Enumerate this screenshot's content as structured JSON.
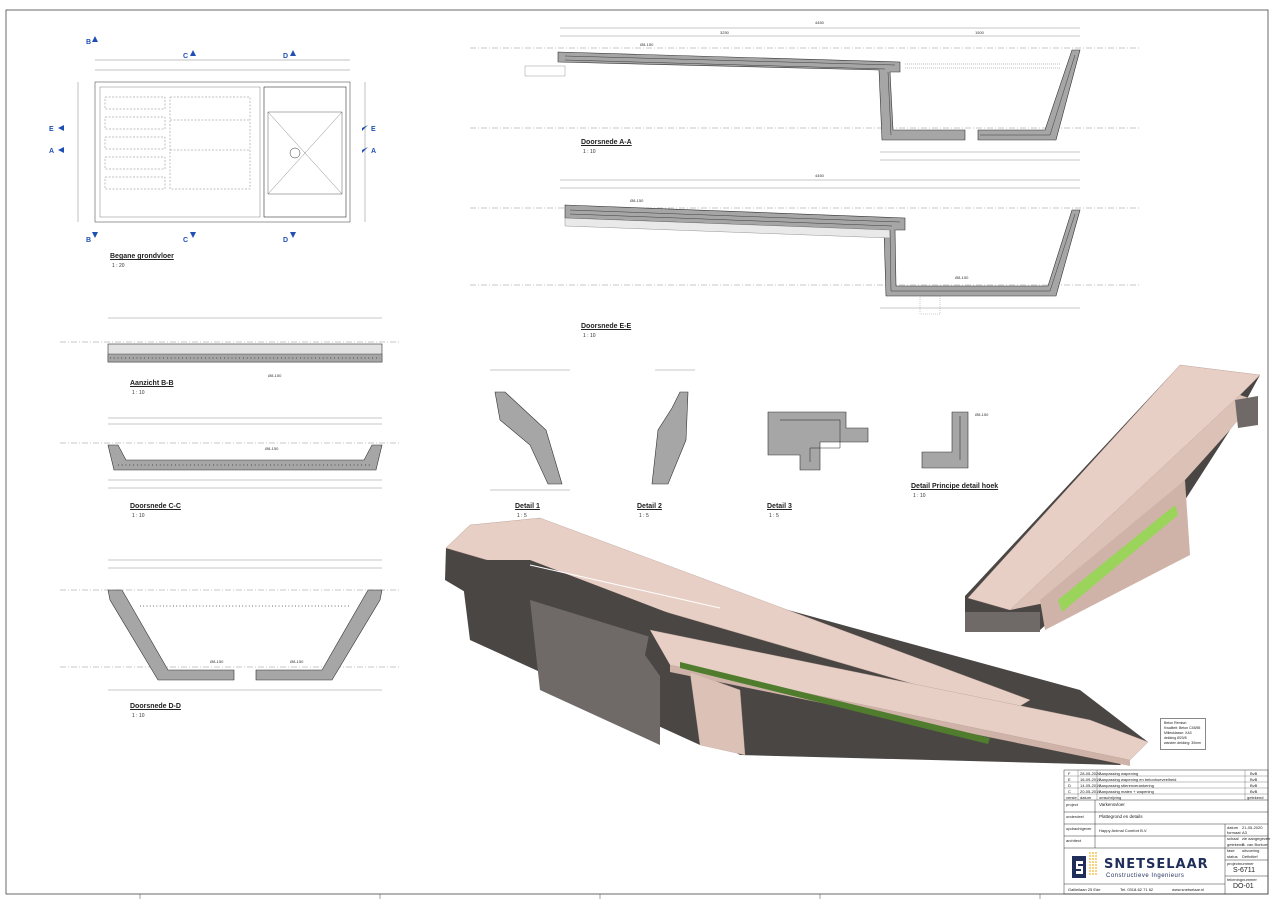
{
  "drawing_views": {
    "begane_grondvloer": {
      "title": "Begane grondvloer",
      "scale": "1 : 20"
    },
    "doorsnede_aa": {
      "title": "Doorsnede A-A",
      "scale": "1 : 10"
    },
    "doorsnede_ee": {
      "title": "Doorsnede E-E",
      "scale": "1 : 10"
    },
    "aanzicht_bb": {
      "title": "Aanzicht B-B",
      "scale": "1 : 10"
    },
    "doorsnede_cc": {
      "title": "Doorsnede C-C",
      "scale": "1 : 10"
    },
    "doorsnede_dd": {
      "title": "Doorsnede D-D",
      "scale": "1 : 10"
    },
    "detail_1": {
      "title": "Detail 1",
      "scale": "1 : 5"
    },
    "detail_2": {
      "title": "Detail 2",
      "scale": "1 : 5"
    },
    "detail_3": {
      "title": "Detail 3",
      "scale": "1 : 5"
    },
    "detail_hoek": {
      "title": "Detail Principe detail hoek",
      "scale": "1 : 10"
    }
  },
  "section_markers": [
    "A",
    "B",
    "C",
    "D",
    "E"
  ],
  "annotations": {
    "rebar_main": "Ø8-150",
    "rebar_mesh": "Ø8-150",
    "dim_total": "4450",
    "dim_left": "3250",
    "dim_right": "1500"
  },
  "beton_note": {
    "heading": "Beton Remise:",
    "lines": [
      "Kwaliteit: Beton C45/55",
      "Milieuklasse: XA3",
      "dekking Ø20/8",
      "wanden dekking: 30mm"
    ]
  },
  "revisions": [
    {
      "rev": "F",
      "date": "28-05-2020",
      "desc": "Aanpassing wapening",
      "by": "BvB"
    },
    {
      "rev": "E",
      "date": "16-09-2019",
      "desc": "Aanpassing wapening en betonhoeveelheid",
      "by": "BvB"
    },
    {
      "rev": "D",
      "date": "14-05-2019",
      "desc": "Aanpassing stierenverankering",
      "by": "BvB"
    },
    {
      "rev": "C",
      "date": "20-05-2019",
      "desc": "Aanpassing maten + wapening",
      "by": "BvB"
    },
    {
      "rev": "versie",
      "date": "datum",
      "desc": "omschrijving",
      "by": "getekend"
    }
  ],
  "title_block": {
    "project_label": "project",
    "project": "Varkensvloer",
    "subject_label": "onderdeel",
    "subject": "Plattegrond en details",
    "client_label": "opdrachtgever",
    "client": "Happy Animal Comfort B.V.",
    "architect_label": "architect",
    "fields": [
      {
        "label": "datum",
        "value": "21-05-2020"
      },
      {
        "label": "formaat",
        "value": "A3"
      },
      {
        "label": "schaal",
        "value": "zie aangegeven"
      },
      {
        "label": "getekend",
        "value": "B. van Borkum"
      },
      {
        "label": "fase",
        "value": "uitvoering"
      },
      {
        "label": "status",
        "value": "Definitief"
      }
    ],
    "project_no_label": "projectnummer",
    "project_no": "S-6711",
    "drawing_no_label": "tekeningnummer",
    "drawing_no": "DO-01"
  },
  "company": {
    "name": "SNETSELAAR",
    "tagline": "Constructieve Ingenieurs",
    "address": "Galileilaan 25  Ede",
    "phone": "Tel. 0318-62 71 62",
    "website": "www.snetselaar.nl"
  },
  "colors": {
    "concrete_fill": "#a6a6a6",
    "render_face_light": "#e8cfc5",
    "render_face_mid": "#cfb2a8",
    "render_face_dark": "#4a4644",
    "render_accent": "#9ad45a",
    "brand": "#1f2f5a",
    "marker_blue": "#1f4fb5"
  }
}
